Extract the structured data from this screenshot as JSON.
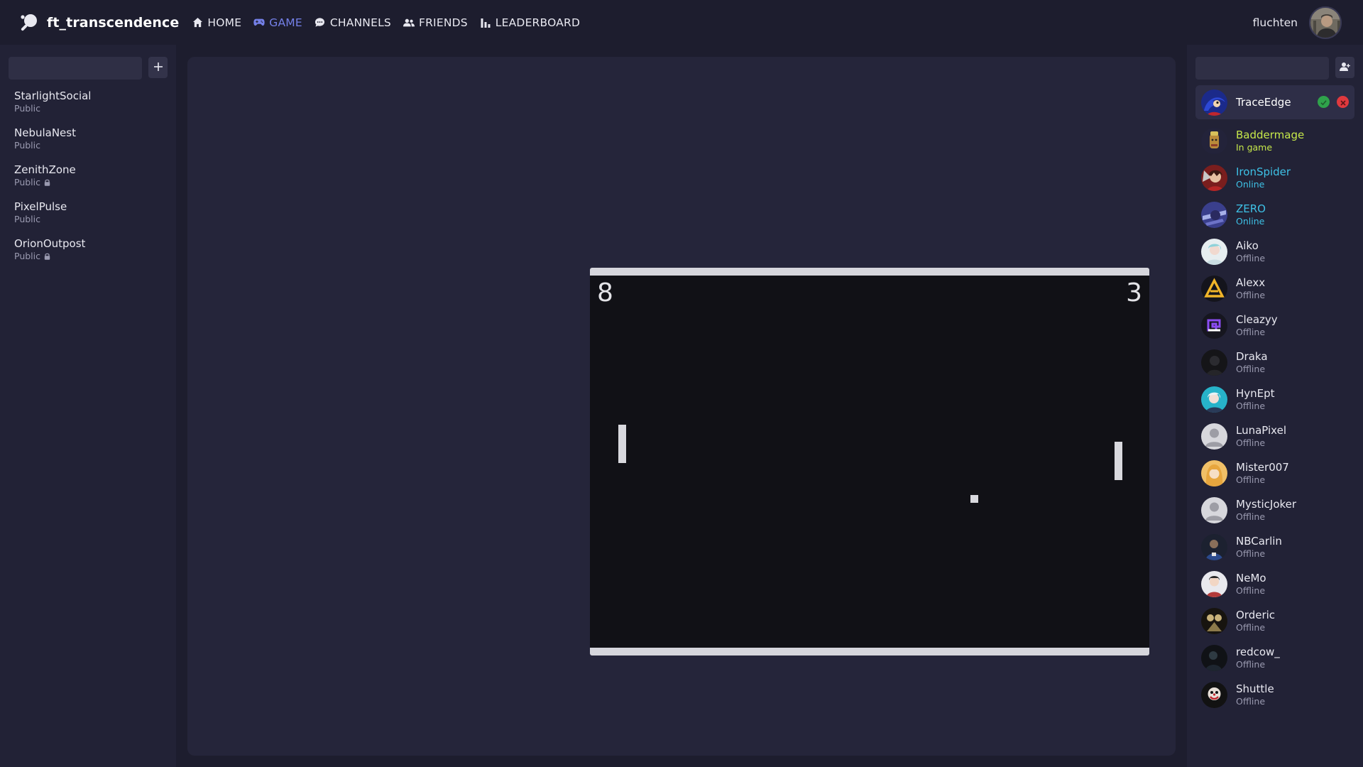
{
  "app": {
    "brand": "ft_transcendence",
    "nav": [
      {
        "label": "HOME",
        "icon": "home-icon"
      },
      {
        "label": "GAME",
        "icon": "gamepad-icon",
        "active": true
      },
      {
        "label": "CHANNELS",
        "icon": "chat-bubble-icon"
      },
      {
        "label": "FRIENDS",
        "icon": "users-icon"
      },
      {
        "label": "LEADERBOARD",
        "icon": "bar-chart-icon"
      }
    ],
    "user": {
      "name": "fluchten"
    },
    "accent_color": "#7480e8"
  },
  "channels": {
    "search_placeholder": "",
    "items": [
      {
        "name": "StarlightSocial",
        "type": "Public",
        "locked": false
      },
      {
        "name": "NebulaNest",
        "type": "Public",
        "locked": false
      },
      {
        "name": "ZenithZone",
        "type": "Public",
        "locked": true
      },
      {
        "name": "PixelPulse",
        "type": "Public",
        "locked": false
      },
      {
        "name": "OrionOutpost",
        "type": "Public",
        "locked": true
      }
    ]
  },
  "game": {
    "score_left": "8",
    "score_right": "3"
  },
  "friends": {
    "search_placeholder": "",
    "request": {
      "name": "TraceEdge"
    },
    "items": [
      {
        "name": "Baddermage",
        "status": "In game",
        "state": "ingame"
      },
      {
        "name": "IronSpider",
        "status": "Online",
        "state": "online"
      },
      {
        "name": "ZERO",
        "status": "Online",
        "state": "online"
      },
      {
        "name": "Aiko",
        "status": "Offline",
        "state": "offline"
      },
      {
        "name": "Alexx",
        "status": "Offline",
        "state": "offline"
      },
      {
        "name": "Cleazyy",
        "status": "Offline",
        "state": "offline"
      },
      {
        "name": "Draka",
        "status": "Offline",
        "state": "offline"
      },
      {
        "name": "HynEpt",
        "status": "Offline",
        "state": "offline"
      },
      {
        "name": "LunaPixel",
        "status": "Offline",
        "state": "offline"
      },
      {
        "name": "Mister007",
        "status": "Offline",
        "state": "offline"
      },
      {
        "name": "MysticJoker",
        "status": "Offline",
        "state": "offline"
      },
      {
        "name": "NBCarlin",
        "status": "Offline",
        "state": "offline"
      },
      {
        "name": "NeMo",
        "status": "Offline",
        "state": "offline"
      },
      {
        "name": "Orderic",
        "status": "Offline",
        "state": "offline"
      },
      {
        "name": "redcow_",
        "status": "Offline",
        "state": "offline"
      },
      {
        "name": "Shuttle",
        "status": "Offline",
        "state": "offline"
      }
    ]
  }
}
